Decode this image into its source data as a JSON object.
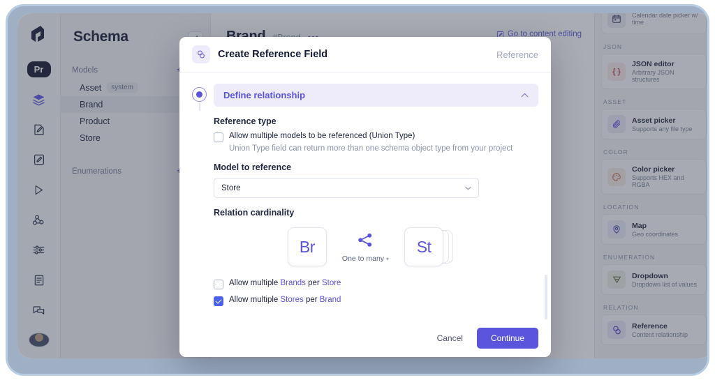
{
  "rail": {
    "project_badge": "Pr",
    "icons": [
      {
        "name": "logo-icon",
        "label": "logo"
      },
      {
        "name": "project-badge",
        "label": "Pr"
      },
      {
        "name": "schema-layers-icon",
        "label": "schema"
      },
      {
        "name": "content-edit-icon",
        "label": "content"
      },
      {
        "name": "media-edit-icon",
        "label": "media"
      },
      {
        "name": "api-playground-icon",
        "label": "playground"
      },
      {
        "name": "webhooks-icon",
        "label": "webhooks"
      },
      {
        "name": "settings-sliders-icon",
        "label": "settings"
      },
      {
        "name": "docs-icon",
        "label": "docs"
      },
      {
        "name": "support-chat-icon",
        "label": "support"
      },
      {
        "name": "user-avatar",
        "label": "account"
      }
    ]
  },
  "schema": {
    "title": "Schema",
    "models_group": {
      "label": "Models",
      "add_label": "+ Add"
    },
    "models": [
      {
        "name": "Asset",
        "tag": "system",
        "selected": false
      },
      {
        "name": "Brand",
        "tag": "",
        "selected": true
      },
      {
        "name": "Product",
        "tag": "",
        "selected": false
      },
      {
        "name": "Store",
        "tag": "",
        "selected": false
      }
    ],
    "enumerations_group": {
      "label": "Enumerations",
      "add_label": "+ Add"
    }
  },
  "main": {
    "title": "Brand",
    "api_id": "#Brand",
    "more_label": "•••",
    "goto_label": "Go to content editing"
  },
  "field_panel": {
    "partial_top": {
      "name": "",
      "desc": "Calendar date picker w/ time"
    },
    "categories": [
      {
        "label": "JSON",
        "items": [
          {
            "name": "JSON editor",
            "desc": "Arbitrary JSON structures",
            "icon": "json-braces-icon",
            "icon_bg": "#f8e9e9",
            "icon_color": "#b8424a"
          }
        ]
      },
      {
        "label": "ASSET",
        "items": [
          {
            "name": "Asset picker",
            "desc": "Supports any file type",
            "icon": "paperclip-icon",
            "icon_bg": "#ebe9fa",
            "icon_color": "#5b54dd"
          }
        ]
      },
      {
        "label": "COLOR",
        "items": [
          {
            "name": "Color picker",
            "desc": "Supports HEX and RGBA",
            "icon": "palette-icon",
            "icon_bg": "#f7ece6",
            "icon_color": "#b3603a"
          }
        ]
      },
      {
        "label": "LOCATION",
        "items": [
          {
            "name": "Map",
            "desc": "Geo coordinates",
            "icon": "map-pin-icon",
            "icon_bg": "#e9ebfa",
            "icon_color": "#3b3fa8"
          }
        ]
      },
      {
        "label": "ENUMERATION",
        "items": [
          {
            "name": "Dropdown",
            "desc": "Dropdown list of values",
            "icon": "dropdown-triangle-icon",
            "icon_bg": "#eceee4",
            "icon_color": "#5a7040"
          }
        ]
      },
      {
        "label": "RELATION",
        "items": [
          {
            "name": "Reference",
            "desc": "Content relationship",
            "icon": "reference-link-icon",
            "icon_bg": "#eae8fa",
            "icon_color": "#4b43cf"
          }
        ]
      }
    ]
  },
  "modal": {
    "title": "Create Reference Field",
    "kind_label": "Reference",
    "header_icon": "reference-link-icon",
    "step": {
      "label": "Define relationship",
      "expanded": true
    },
    "reference_type": {
      "label": "Reference type",
      "union_checkbox": {
        "label": "Allow multiple models to be referenced (Union Type)",
        "checked": false
      },
      "union_help": "Union Type field can return more than one schema object type from your project"
    },
    "model_to_reference": {
      "label": "Model to reference",
      "value": "Store"
    },
    "cardinality": {
      "label": "Relation cardinality",
      "left_entity": "Br",
      "right_entity": "St",
      "relation_label": "One to many",
      "right_is_many": true,
      "options": [
        {
          "label": "Allow multiple Brands per Store",
          "checked": false,
          "a": "Brands",
          "b": "Store",
          "prefix": "Allow multiple ",
          "mid": " per "
        },
        {
          "label": "Allow multiple Stores per Brand",
          "checked": true,
          "a": "Stores",
          "b": "Brand",
          "prefix": "Allow multiple ",
          "mid": " per "
        }
      ]
    },
    "footer": {
      "cancel": "Cancel",
      "continue": "Continue"
    }
  },
  "colors": {
    "accent": "#5b54dd",
    "accent_soft": "#eeecfb",
    "checkbox_checked": "#4a62e8",
    "text_dark": "#151a33",
    "text_muted": "#8d95ad"
  }
}
